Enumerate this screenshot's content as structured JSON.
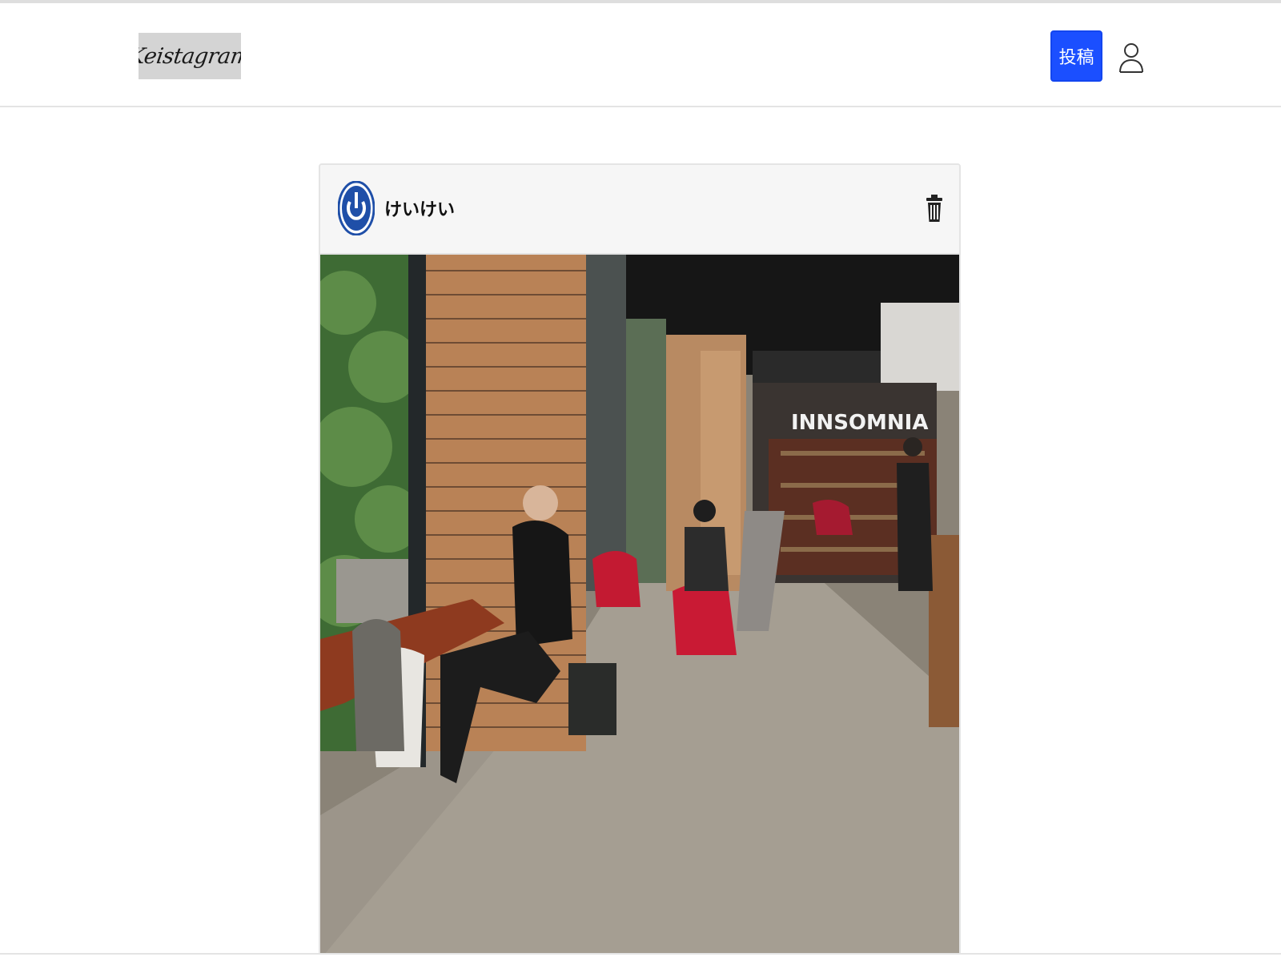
{
  "header": {
    "logo_text": "Keistagram",
    "post_button_label": "投稿",
    "user_icon": "user-icon"
  },
  "post": {
    "username": "けいけい",
    "avatar_icon": "power-logo-avatar",
    "delete_icon": "trash-icon",
    "photo": {
      "description_sign": "INNSOMNIA"
    }
  },
  "colors": {
    "accent": "#1b4fff",
    "avatar_blue": "#1f4fa8",
    "border": "#e4e4e4",
    "card_header_bg": "#f6f6f6"
  }
}
